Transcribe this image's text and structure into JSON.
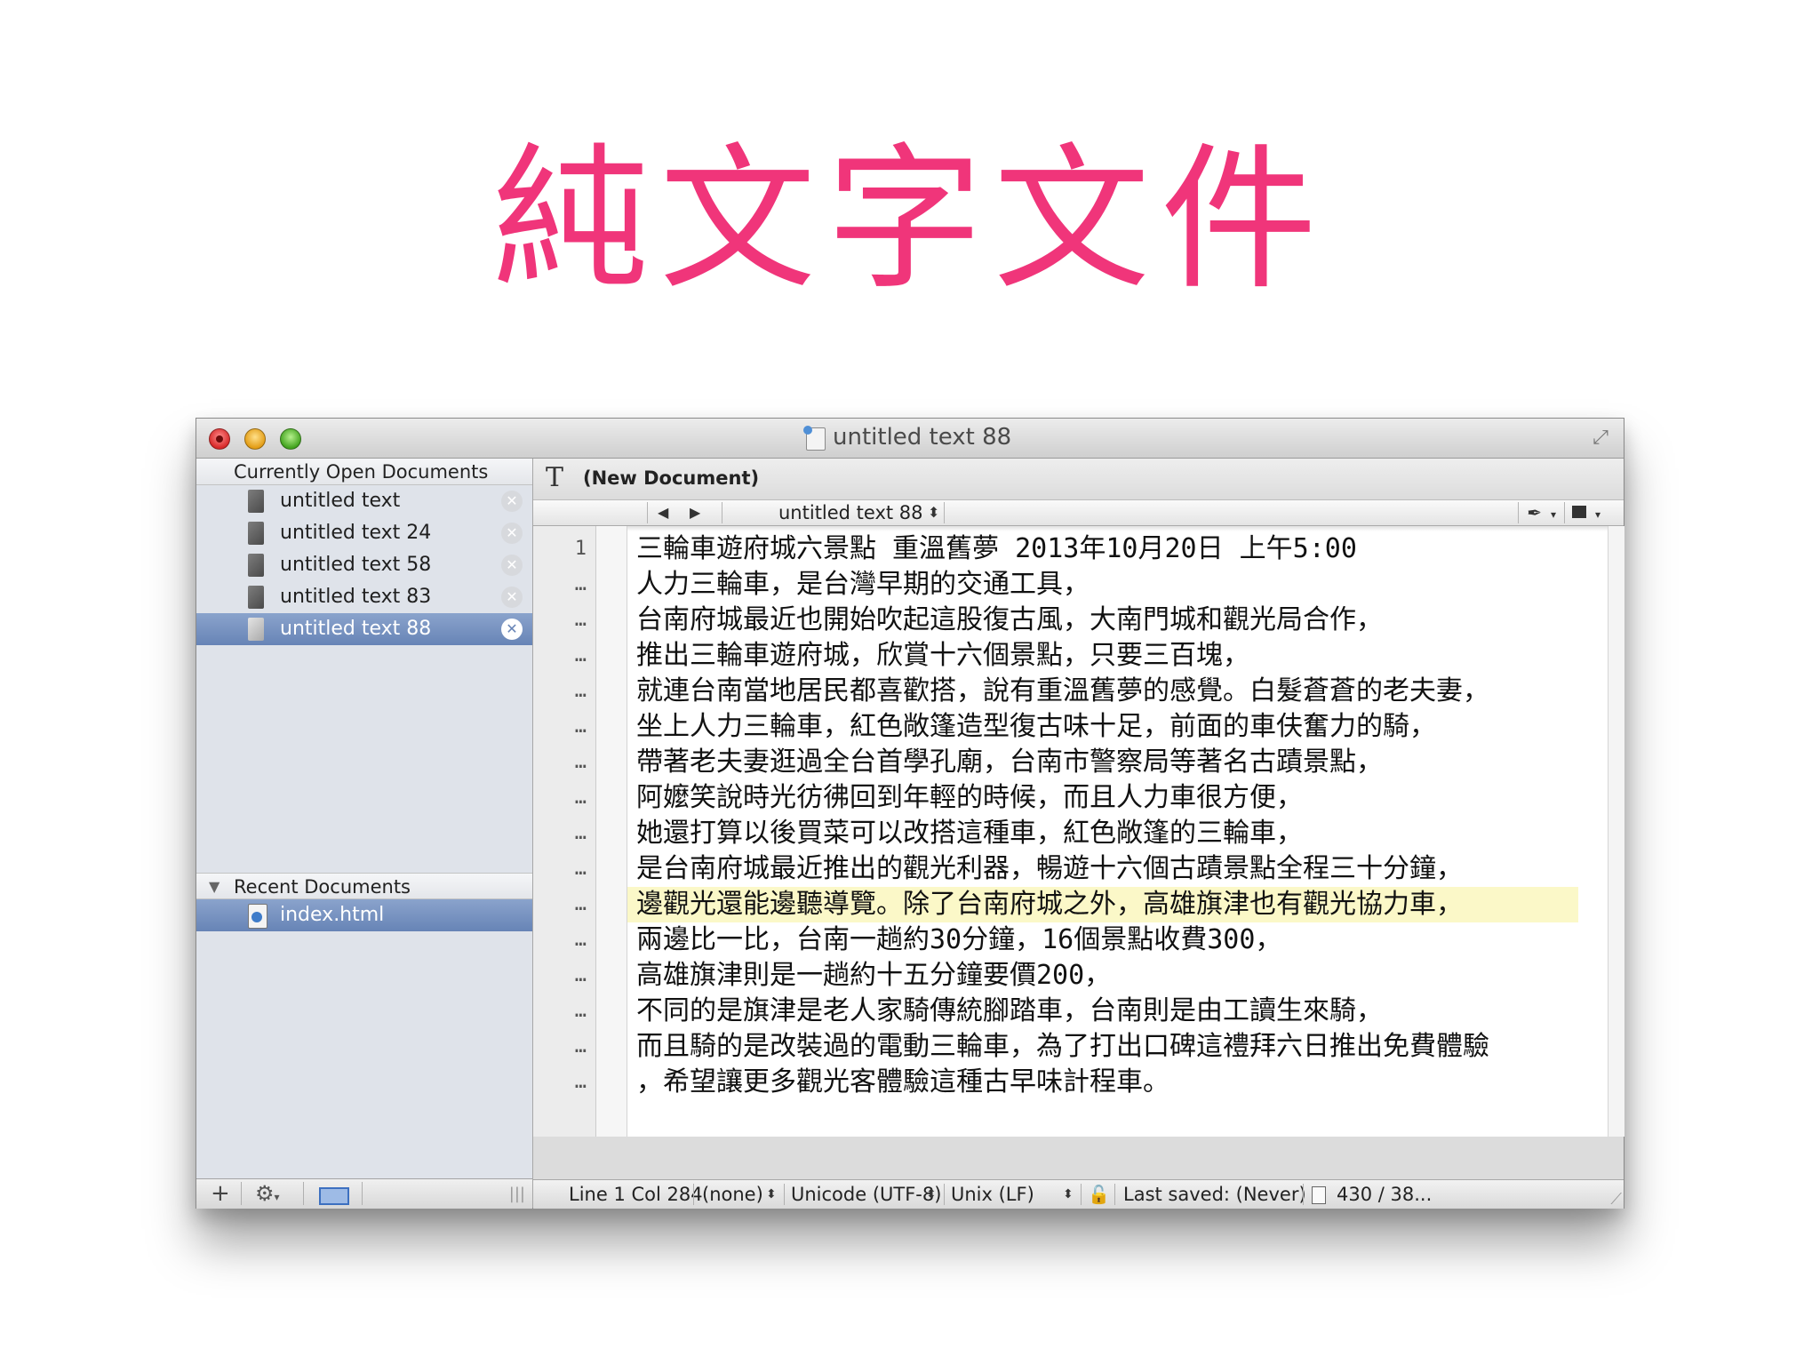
{
  "slide": {
    "title": "純文字文件",
    "title_color": "#f0357a"
  },
  "window": {
    "title": "untitled text 88"
  },
  "sidebar": {
    "open_header": "Currently Open Documents",
    "open_docs": [
      {
        "label": "untitled text"
      },
      {
        "label": "untitled text 24"
      },
      {
        "label": "untitled text 58"
      },
      {
        "label": "untitled text 83"
      },
      {
        "label": "untitled text 88",
        "selected": true
      }
    ],
    "recent_header": "Recent Documents",
    "recent_docs": [
      {
        "label": "index.html"
      }
    ],
    "toolbar": {
      "add": "+",
      "gear": "⚙",
      "gear_chevron": "▾",
      "grip": "|||"
    }
  },
  "editor": {
    "header_title": "(New Document)",
    "text_tool_icon": "T",
    "nav": {
      "back": "◀",
      "forward": "▶",
      "doc_name": "untitled text 88",
      "popup_chevron": "⬍",
      "pen_icon": "✒",
      "chevron": "▾"
    },
    "gutter": [
      "1",
      "…",
      "…",
      "…",
      "…",
      "…",
      "…",
      "…",
      "…",
      "…",
      "…",
      "…",
      "…",
      "…",
      "…",
      "…"
    ],
    "current_line_index": 10,
    "lines": [
      "三輪車遊府城六景點 重溫舊夢 2013年10月20日 上午5:00",
      "人力三輪車，是台灣早期的交通工具，",
      "台南府城最近也開始吹起這股復古風，大南門城和觀光局合作，",
      "推出三輪車遊府城，欣賞十六個景點，只要三百塊，",
      "就連台南當地居民都喜歡搭，說有重溫舊夢的感覺。白髮蒼蒼的老夫妻，",
      "坐上人力三輪車，紅色敞篷造型復古味十足，前面的車伕奮力的騎，",
      "帶著老夫妻逛過全台首學孔廟，台南市警察局等著名古蹟景點，",
      "阿嬤笑說時光彷彿回到年輕的時候，而且人力車很方便，",
      "她還打算以後買菜可以改搭這種車，紅色敞篷的三輪車，",
      "是台南府城最近推出的觀光利器，暢遊十六個古蹟景點全程三十分鐘，",
      "邊觀光還能邊聽導覽。除了台南府城之外，高雄旗津也有觀光協力車，",
      "兩邊比一比，台南一趟約30分鐘，16個景點收費300，",
      "高雄旗津則是一趟約十五分鐘要價200，",
      "不同的是旗津是老人家騎傳統腳踏車，台南則是由工讀生來騎，",
      "而且騎的是改裝過的電動三輪車，為了打出口碑這禮拜六日推出免費體驗",
      "，希望讓更多觀光客體驗這種古早味計程車。"
    ]
  },
  "status": {
    "position": "Line 1 Col 284",
    "syntax": "(none)",
    "encoding": "Unicode (UTF-8)",
    "line_endings": "Unix (LF)",
    "chevron": "⬍",
    "lock_icon": "🔓",
    "last_saved": "Last saved: (Never)",
    "counts": "430 / 38...",
    "resize": "⟋"
  }
}
